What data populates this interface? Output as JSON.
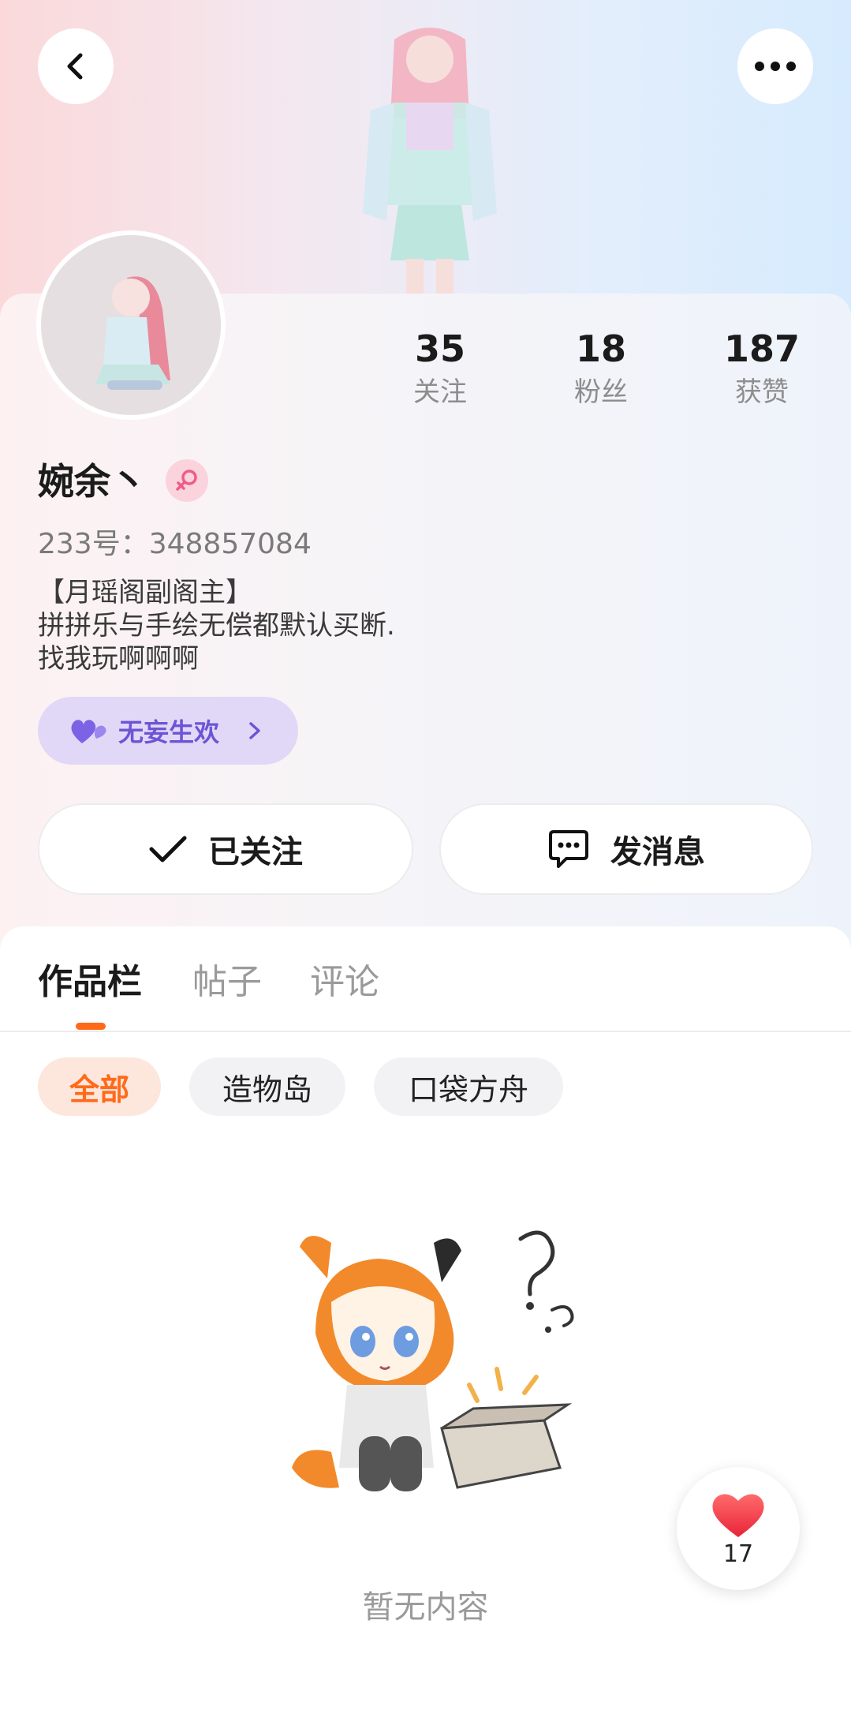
{
  "header": {
    "back_icon": "chevron-left-icon",
    "more_icon": "more-dots-icon"
  },
  "profile": {
    "stats": [
      {
        "value": "35",
        "label": "关注"
      },
      {
        "value": "18",
        "label": "粉丝"
      },
      {
        "value": "187",
        "label": "获赞"
      }
    ],
    "name": "婉余丶",
    "gender_icon": "female-icon",
    "uid": "233号：348857084",
    "bio": [
      "【月瑶阁副阁主】",
      "拼拼乐与手绘无偿都默认买断.",
      "找我玩啊啊啊"
    ],
    "guild": {
      "name": "无妄生欢",
      "icon": "heart-icon"
    }
  },
  "actions": {
    "follow_label": "已关注",
    "message_label": "发消息"
  },
  "tabs": [
    {
      "label": "作品栏",
      "active": true
    },
    {
      "label": "帖子",
      "active": false
    },
    {
      "label": "评论",
      "active": false
    }
  ],
  "filters": [
    {
      "label": "全部",
      "active": true
    },
    {
      "label": "造物岛",
      "active": false
    },
    {
      "label": "口袋方舟",
      "active": false
    }
  ],
  "empty_state": {
    "text": "暂无内容"
  },
  "like_fab": {
    "count": "17"
  },
  "colors": {
    "accent": "#ff6a1a",
    "guild_text": "#6b55d6",
    "guild_bg": "#e1d8f7"
  }
}
